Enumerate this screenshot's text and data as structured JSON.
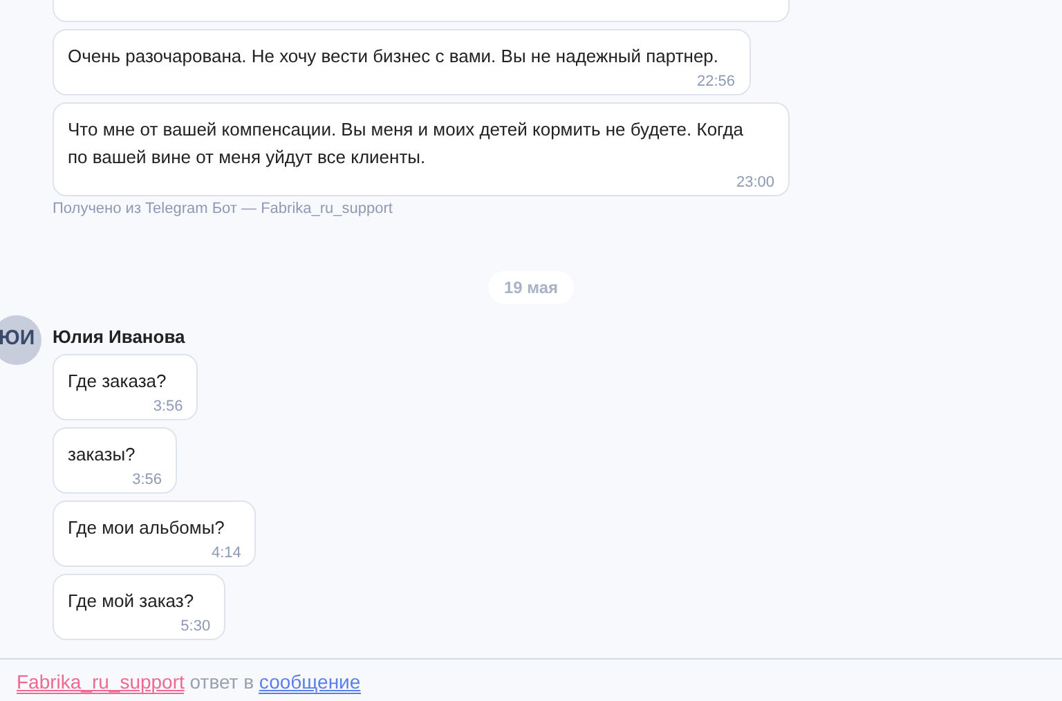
{
  "groups": [
    {
      "partial_first": true,
      "messages": [
        {
          "text": "Очень разочарована. Не хочу вести бизнес с вами. Вы не надежный партнер.",
          "time": "22:56"
        },
        {
          "text": "Что мне от вашей компенсации. Вы меня и моих детей кормить не будете. Когда по вашей вине от меня уйдут все клиенты.",
          "time": "23:00"
        }
      ],
      "source": "Получено из Telegram Бот — Fabrika_ru_support"
    },
    {
      "date": "19 мая"
    },
    {
      "sender": {
        "name": "Юлия Иванова",
        "initials": "ЮИ"
      },
      "messages": [
        {
          "text": "Где заказа?",
          "time": "3:56"
        },
        {
          "text": "заказы?",
          "time": "3:56"
        },
        {
          "text": "Где мои альбомы?",
          "time": "4:14"
        },
        {
          "text": "Где мой заказ?",
          "time": "5:30"
        }
      ]
    }
  ],
  "reply_bar": {
    "author": "Fabrika_ru_support",
    "middle": "ответ в",
    "target": "сообщение"
  }
}
